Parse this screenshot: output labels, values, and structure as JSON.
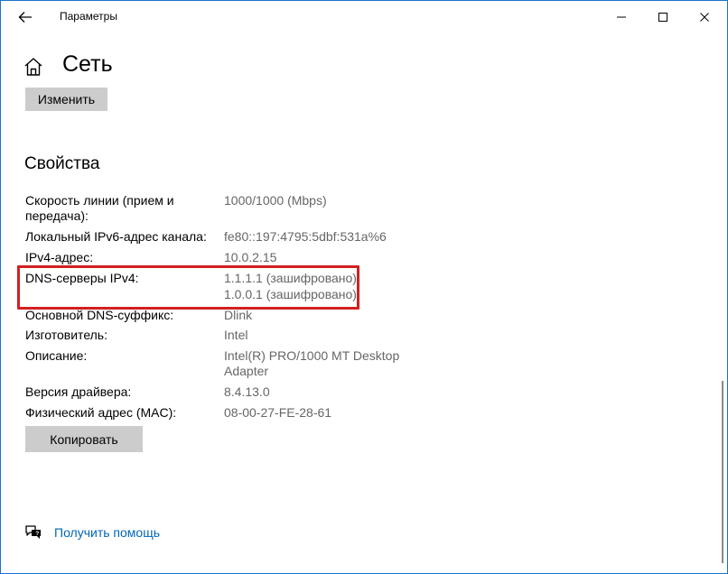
{
  "window": {
    "title": "Параметры"
  },
  "header": {
    "title": "Сеть"
  },
  "actions": {
    "change_label": "Изменить",
    "copy_label": "Копировать"
  },
  "properties": {
    "section_title": "Свойства",
    "link_speed_label": "Скорость линии (прием и передача):",
    "link_speed_value": "1000/1000 (Mbps)",
    "ipv6_label": "Локальный IPv6-адрес канала:",
    "ipv6_value": "fe80::197:4795:5dbf:531a%6",
    "ipv4_label": "IPv4-адрес:",
    "ipv4_value": "10.0.2.15",
    "dns_label": "DNS-серверы IPv4:",
    "dns_value_1": "1.1.1.1 (зашифровано)",
    "dns_value_2": "1.0.0.1 (зашифровано)",
    "dns_suffix_label": "Основной DNS-суффикс:",
    "dns_suffix_value": "Dlink",
    "manufacturer_label": "Изготовитель:",
    "manufacturer_value": "Intel",
    "description_label": "Описание:",
    "description_value": "Intel(R) PRO/1000 MT Desktop Adapter",
    "driver_label": "Версия драйвера:",
    "driver_value": "8.4.13.0",
    "mac_label": "Физический адрес (MAC):",
    "mac_value": "08-00-27-FE-28-61"
  },
  "help": {
    "link_label": "Получить помощь"
  },
  "colors": {
    "accent_link": "#0067b8",
    "highlight_border": "#d22020",
    "button_bg": "#cccccc",
    "value_text": "#666666"
  }
}
